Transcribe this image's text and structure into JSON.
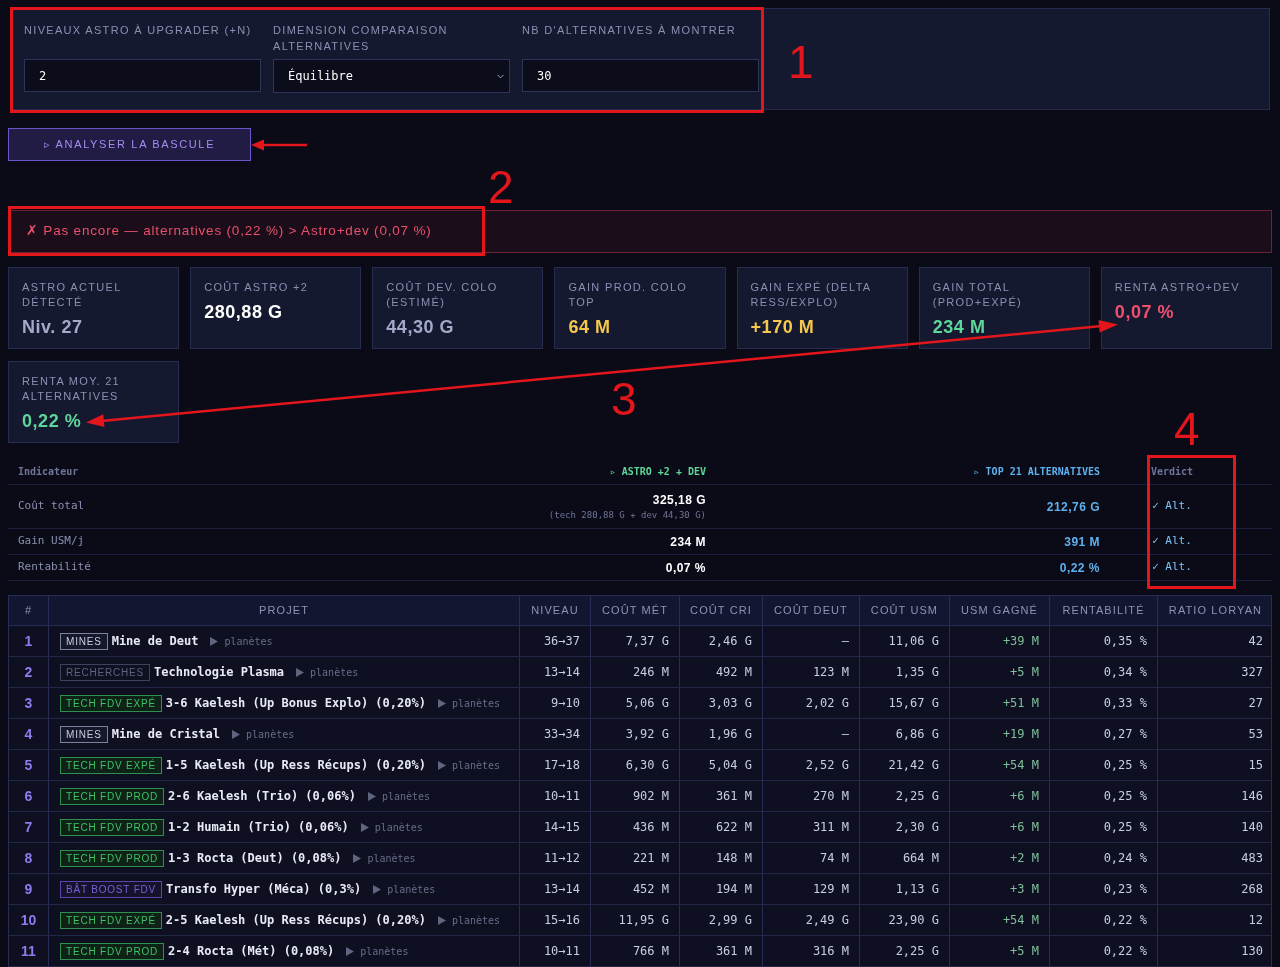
{
  "settings": {
    "fields": [
      {
        "kind": "input",
        "label": "NIVEAUX ASTRO À UPGRADER (+N)",
        "value": "2"
      },
      {
        "kind": "select",
        "label": "DIMENSION COMPARAISON ALTERNATIVES",
        "value": "Équilibre"
      },
      {
        "kind": "input",
        "label": "NB D'ALTERNATIVES À MONTRER",
        "value": "30"
      }
    ]
  },
  "analyze_button": {
    "label": "▹ ANALYSER LA BASCULE"
  },
  "verdict_banner": {
    "positive": false,
    "text": "✗ Pas encore — alternatives (0,22 %) > Astro+dev (0,07 %)"
  },
  "stats": [
    {
      "label": "ASTRO ACTUEL DÉTECTÉ",
      "value": "Niv. 27",
      "color": "#a3a9c9"
    },
    {
      "label": "COÛT ASTRO +2",
      "value": "280,88 G",
      "color": "#ffffff"
    },
    {
      "label": "COÛT DEV. COLO (ESTIMÉ)",
      "value": "44,30 G",
      "color": "#a3a9c9"
    },
    {
      "label": "GAIN PROD. COLO TOP",
      "value": "64 M",
      "color": "#f5c84c"
    },
    {
      "label": "GAIN EXPÉ (DELTA RESS/EXPLO)",
      "value": "+170 M",
      "color": "#f5c84c"
    },
    {
      "label": "GAIN TOTAL (PROD+EXPÉ)",
      "value": "234 M",
      "color": "#5ed69a"
    },
    {
      "label": "RENTA ASTRO+DEV",
      "value": "0,07 %",
      "color": "#f0506e"
    },
    {
      "label": "RENTA MOY. 21 ALTERNATIVES",
      "value": "0,22 %",
      "color": "#5ed69a"
    }
  ],
  "comparison": {
    "columns": [
      "Indicateur",
      "▹ ASTRO +2 + DEV",
      "▹ TOP 21 ALTERNATIVES",
      "Verdict"
    ],
    "rows": [
      {
        "indicator": "Coût total",
        "astro": "325,18 G",
        "astro_detail": "(tech 280,88 G + dev 44,30 G)",
        "alternatives": "212,76 G",
        "verdict": "✓ Alt."
      },
      {
        "indicator": "Gain USM/j",
        "astro": "234 M",
        "alternatives": "391 M",
        "verdict": "✓ Alt."
      },
      {
        "indicator": "Rentabilité",
        "astro": "0,07 %",
        "alternatives": "0,22 %",
        "verdict": "✓ Alt."
      }
    ]
  },
  "projects_table": {
    "columns": [
      "#",
      "PROJET",
      "NIVEAU",
      "COÛT MÉT",
      "COÛT CRI",
      "COÛT DEUT",
      "COÛT USM",
      "USM GAGNÉ",
      "RENTABILITÉ",
      "RATIO LORYAN"
    ],
    "rows": [
      {
        "rank": "1",
        "project": {
          "tag": {
            "text": "MINES",
            "kind": "mines"
          },
          "name": "Mine de Deut",
          "link": "planètes"
        },
        "level": "36→37",
        "cost_met": "7,37 G",
        "cost_cri": "2,46 G",
        "cost_deut": "—",
        "cost_usm": "11,06 G",
        "usm_gain": "+39 M",
        "profitability": "0,35 %",
        "ratio": "42"
      },
      {
        "rank": "2",
        "project": {
          "tag": {
            "text": "RECHERCHES",
            "kind": "research"
          },
          "name": "Technologie Plasma",
          "link": "planètes"
        },
        "level": "13→14",
        "cost_met": "246 M",
        "cost_cri": "492 M",
        "cost_deut": "123 M",
        "cost_usm": "1,35 G",
        "usm_gain": "+5 M",
        "profitability": "0,34 %",
        "ratio": "327"
      },
      {
        "rank": "3",
        "project": {
          "tag": {
            "text": "TECH FDV EXPÉ",
            "kind": "tech"
          },
          "name": "3-6 Kaelesh (Up Bonus Explo) (0,20%)",
          "link": "planètes"
        },
        "level": "9→10",
        "cost_met": "5,06 G",
        "cost_cri": "3,03 G",
        "cost_deut": "2,02 G",
        "cost_usm": "15,67 G",
        "usm_gain": "+51 M",
        "profitability": "0,33 %",
        "ratio": "27"
      },
      {
        "rank": "4",
        "project": {
          "tag": {
            "text": "MINES",
            "kind": "mines"
          },
          "name": "Mine de Cristal",
          "link": "planètes"
        },
        "level": "33→34",
        "cost_met": "3,92 G",
        "cost_cri": "1,96 G",
        "cost_deut": "—",
        "cost_usm": "6,86 G",
        "usm_gain": "+19 M",
        "profitability": "0,27 %",
        "ratio": "53"
      },
      {
        "rank": "5",
        "project": {
          "tag": {
            "text": "TECH FDV EXPÉ",
            "kind": "tech"
          },
          "name": "1-5 Kaelesh (Up Ress Récups) (0,20%)",
          "link": "planètes"
        },
        "level": "17→18",
        "cost_met": "6,30 G",
        "cost_cri": "5,04 G",
        "cost_deut": "2,52 G",
        "cost_usm": "21,42 G",
        "usm_gain": "+54 M",
        "profitability": "0,25 %",
        "ratio": "15"
      },
      {
        "rank": "6",
        "project": {
          "tag": {
            "text": "TECH FDV PROD",
            "kind": "tech"
          },
          "name": "2-6 Kaelesh (Trio) (0,06%)",
          "link": "planètes"
        },
        "level": "10→11",
        "cost_met": "902 M",
        "cost_cri": "361 M",
        "cost_deut": "270 M",
        "cost_usm": "2,25 G",
        "usm_gain": "+6 M",
        "profitability": "0,25 %",
        "ratio": "146"
      },
      {
        "rank": "7",
        "project": {
          "tag": {
            "text": "TECH FDV PROD",
            "kind": "tech"
          },
          "name": "1-2 Humain (Trio) (0,06%)",
          "link": "planètes"
        },
        "level": "14→15",
        "cost_met": "436 M",
        "cost_cri": "622 M",
        "cost_deut": "311 M",
        "cost_usm": "2,30 G",
        "usm_gain": "+6 M",
        "profitability": "0,25 %",
        "ratio": "140"
      },
      {
        "rank": "8",
        "project": {
          "tag": {
            "text": "TECH FDV PROD",
            "kind": "tech"
          },
          "name": "1-3 Rocta (Deut) (0,08%)",
          "link": "planètes"
        },
        "level": "11→12",
        "cost_met": "221 M",
        "cost_cri": "148 M",
        "cost_deut": "74 M",
        "cost_usm": "664 M",
        "usm_gain": "+2 M",
        "profitability": "0,24 %",
        "ratio": "483"
      },
      {
        "rank": "9",
        "project": {
          "tag": {
            "text": "BÂT BOOST FDV",
            "kind": "boost"
          },
          "name": "Transfo Hyper (Méca) (0,3%)",
          "link": "planètes"
        },
        "level": "13→14",
        "cost_met": "452 M",
        "cost_cri": "194 M",
        "cost_deut": "129 M",
        "cost_usm": "1,13 G",
        "usm_gain": "+3 M",
        "profitability": "0,23 %",
        "ratio": "268"
      },
      {
        "rank": "10",
        "project": {
          "tag": {
            "text": "TECH FDV EXPÉ",
            "kind": "tech"
          },
          "name": "2-5 Kaelesh (Up Ress Récups) (0,20%)",
          "link": "planètes"
        },
        "level": "15→16",
        "cost_met": "11,95 G",
        "cost_cri": "2,99 G",
        "cost_deut": "2,49 G",
        "cost_usm": "23,90 G",
        "usm_gain": "+54 M",
        "profitability": "0,22 %",
        "ratio": "12"
      },
      {
        "rank": "11",
        "project": {
          "tag": {
            "text": "TECH FDV PROD",
            "kind": "tech"
          },
          "name": "2-4 Rocta (Mét) (0,08%)",
          "link": "planètes"
        },
        "level": "10→11",
        "cost_met": "766 M",
        "cost_cri": "361 M",
        "cost_deut": "316 M",
        "cost_usm": "2,25 G",
        "usm_gain": "+5 M",
        "profitability": "0,22 %",
        "ratio": "130"
      }
    ]
  },
  "annotations": [
    {
      "label": "1"
    },
    {
      "label": "2"
    },
    {
      "label": "3"
    },
    {
      "label": "4"
    }
  ]
}
